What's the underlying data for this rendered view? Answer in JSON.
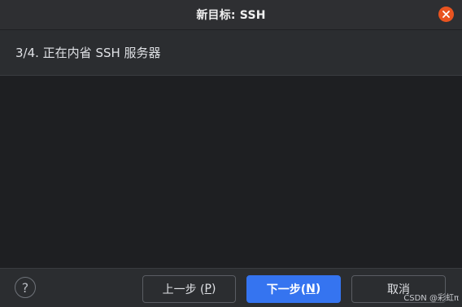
{
  "window": {
    "title": "新目标: SSH"
  },
  "step": {
    "text": "3/4. 正在内省 SSH 服务器"
  },
  "footer": {
    "help_label": "?",
    "prev_label": "上一步 (",
    "prev_mnemonic": "P",
    "prev_suffix": ")",
    "next_label": "下一步(",
    "next_mnemonic": "N",
    "next_suffix": ")",
    "cancel_label": "取消"
  },
  "watermark": "CSDN @彩虹π",
  "colors": {
    "accent": "#3574f0",
    "close": "#e95420",
    "content_bg": "#1e1f22",
    "panel_bg": "#2b2d30"
  },
  "icons": {
    "close": "close-icon",
    "help": "help-icon"
  }
}
